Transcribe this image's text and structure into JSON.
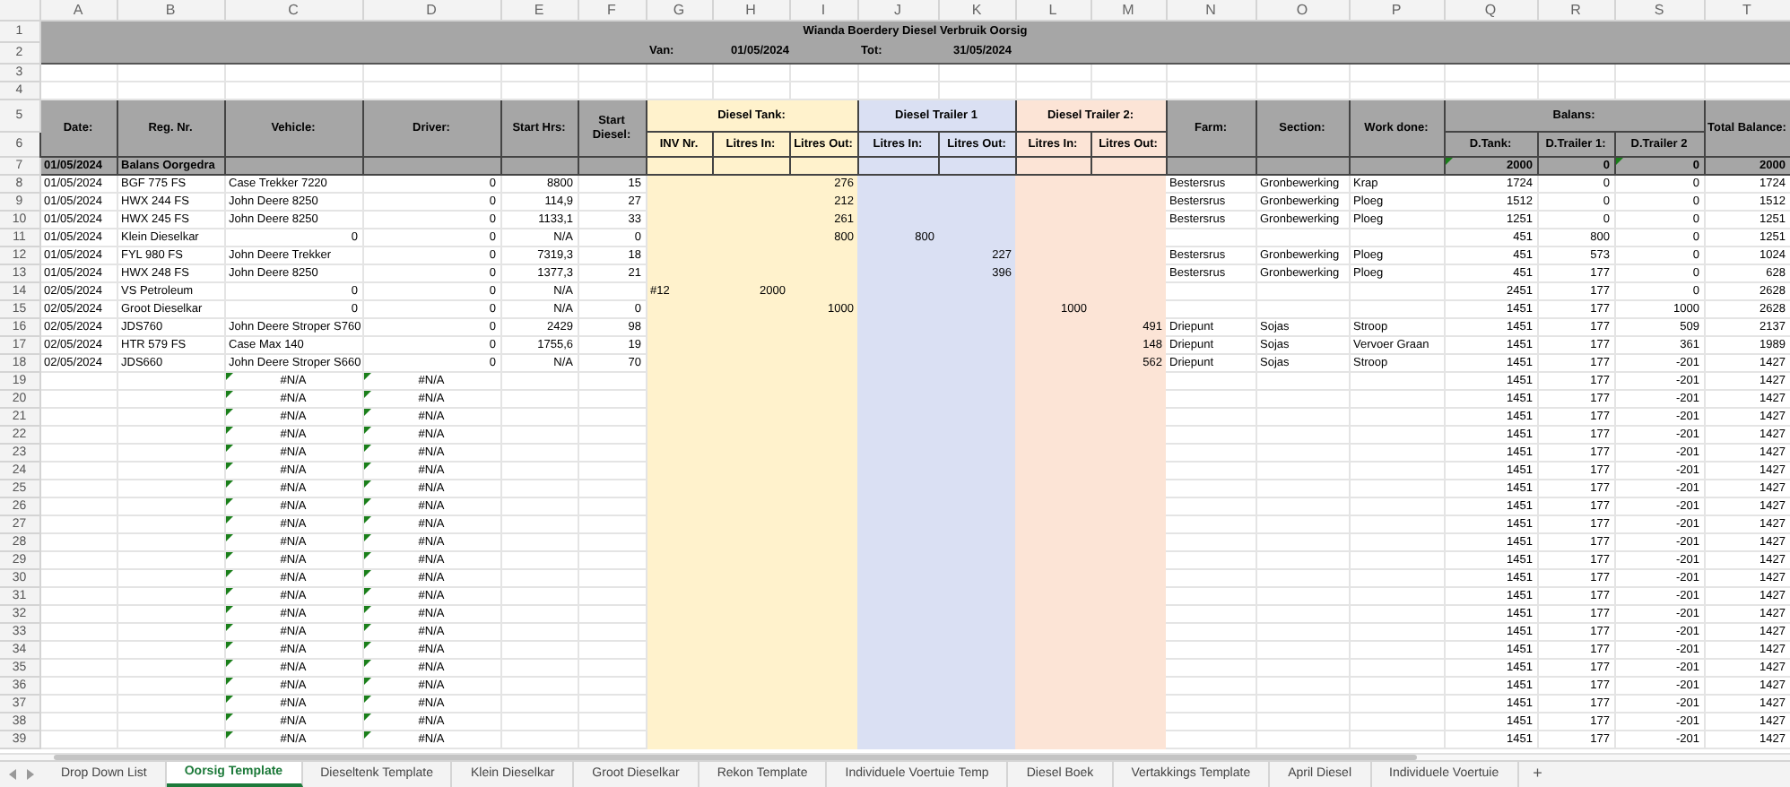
{
  "columns": [
    "A",
    "B",
    "C",
    "D",
    "E",
    "F",
    "G",
    "H",
    "I",
    "J",
    "K",
    "L",
    "M",
    "N",
    "O",
    "P",
    "Q",
    "R",
    "S",
    "T"
  ],
  "title_band": {
    "rows": [
      "1",
      "2"
    ],
    "title": "Wianda Boerdery Diesel Verbruik Oorsig",
    "from_label": "Van:",
    "from": "01/05/2024",
    "to_label": "Tot:",
    "to": "31/05/2024"
  },
  "blank_rows": [
    "3",
    "4"
  ],
  "header_rows": [
    "5",
    "6"
  ],
  "headers": [
    {
      "label": "Date:"
    },
    {
      "label": "Reg. Nr."
    },
    {
      "label": "Vehicle:"
    },
    {
      "label": "Driver:"
    },
    {
      "label": "Start Hrs:"
    },
    {
      "label": "Start Diesel:"
    },
    {
      "label": "Diesel Tank:",
      "color": "#fff2cc",
      "children": [
        "INV Nr.",
        "Litres In:",
        "Litres Out:"
      ]
    },
    {
      "label": "Diesel Trailer 1",
      "color": "#dae0f3",
      "children": [
        "Litres In:",
        "Litres Out:"
      ]
    },
    {
      "label": "Diesel Trailer 2:",
      "color": "#fce4d6",
      "children": [
        "Litres In:",
        "Litres Out:"
      ]
    },
    {
      "label": "Farm:"
    },
    {
      "label": "Section:"
    },
    {
      "label": "Work done:"
    },
    {
      "label": "Balans:",
      "children": [
        "D.Tank:",
        "D.Trailer 1:",
        "D.Trailer 2"
      ]
    },
    {
      "label": "Total Balance:"
    }
  ],
  "rows": [
    {
      "n": "7",
      "kind": "carry",
      "flags": {
        "Q": true,
        "S": true
      },
      "cells": {
        "A": "01/05/2024",
        "B": "Balans Oorgedra",
        "Q": "2000",
        "R": "0",
        "S": "0",
        "T": "2000"
      }
    },
    {
      "n": "8",
      "kind": "entry",
      "cells": {
        "A": "01/05/2024",
        "B": "BGF 775 FS",
        "C": "Case Trekker 7220",
        "D": "0",
        "E": "8800",
        "F": "15",
        "I": "276",
        "N": "Bestersrus",
        "O": "Gronbewerking",
        "P": "Krap",
        "Q": "1724",
        "R": "0",
        "S": "0",
        "T": "1724"
      }
    },
    {
      "n": "9",
      "kind": "entry",
      "cells": {
        "A": "01/05/2024",
        "B": "HWX 244 FS",
        "C": "John Deere 8250",
        "D": "0",
        "E": "114,9",
        "F": "27",
        "I": "212",
        "N": "Bestersrus",
        "O": "Gronbewerking",
        "P": "Ploeg",
        "Q": "1512",
        "R": "0",
        "S": "0",
        "T": "1512"
      }
    },
    {
      "n": "10",
      "kind": "entry",
      "cells": {
        "A": "01/05/2024",
        "B": "HWX 245 FS",
        "C": "John Deere 8250",
        "D": "0",
        "E": "1133,1",
        "F": "33",
        "I": "261",
        "N": "Bestersrus",
        "O": "Gronbewerking",
        "P": "Ploeg",
        "Q": "1251",
        "R": "0",
        "S": "0",
        "T": "1251"
      }
    },
    {
      "n": "11",
      "kind": "entry",
      "cells": {
        "A": "01/05/2024",
        "B": "Klein Dieselkar",
        "C": "0",
        "D": "0",
        "E": "N/A",
        "F": "0",
        "I": "800",
        "J": "800",
        "Q": "451",
        "R": "800",
        "S": "0",
        "T": "1251"
      }
    },
    {
      "n": "12",
      "kind": "entry",
      "cells": {
        "A": "01/05/2024",
        "B": "FYL 980 FS",
        "C": "John Deere Trekker",
        "D": "0",
        "E": "7319,3",
        "F": "18",
        "K": "227",
        "N": "Bestersrus",
        "O": "Gronbewerking",
        "P": "Ploeg",
        "Q": "451",
        "R": "573",
        "S": "0",
        "T": "1024"
      }
    },
    {
      "n": "13",
      "kind": "entry",
      "cells": {
        "A": "01/05/2024",
        "B": "HWX 248 FS",
        "C": "John Deere 8250",
        "D": "0",
        "E": "1377,3",
        "F": "21",
        "K": "396",
        "N": "Bestersrus",
        "O": "Gronbewerking",
        "P": "Ploeg",
        "Q": "451",
        "R": "177",
        "S": "0",
        "T": "628"
      }
    },
    {
      "n": "14",
      "kind": "entry",
      "cells": {
        "A": "02/05/2024",
        "B": "VS Petroleum",
        "C": "0",
        "D": "0",
        "E": "N/A",
        "G": "#12",
        "H": "2000",
        "Q": "2451",
        "R": "177",
        "S": "0",
        "T": "2628"
      }
    },
    {
      "n": "15",
      "kind": "entry",
      "cells": {
        "A": "02/05/2024",
        "B": "Groot Dieselkar",
        "C": "0",
        "D": "0",
        "E": "N/A",
        "F": "0",
        "I": "1000",
        "L": "1000",
        "Q": "1451",
        "R": "177",
        "S": "1000",
        "T": "2628"
      }
    },
    {
      "n": "16",
      "kind": "entry",
      "cells": {
        "A": "02/05/2024",
        "B": "JDS760",
        "C": "John Deere Stroper S760",
        "D": "0",
        "E": "2429",
        "F": "98",
        "M": "491",
        "N": "Driepunt",
        "O": "Sojas",
        "P": "Stroop",
        "Q": "1451",
        "R": "177",
        "S": "509",
        "T": "2137"
      }
    },
    {
      "n": "17",
      "kind": "entry",
      "cells": {
        "A": "02/05/2024",
        "B": "HTR 579 FS",
        "C": "Case Max 140",
        "D": "0",
        "E": "1755,6",
        "F": "19",
        "M": "148",
        "N": "Driepunt",
        "O": "Sojas",
        "P": "Vervoer Graan",
        "Q": "1451",
        "R": "177",
        "S": "361",
        "T": "1989"
      }
    },
    {
      "n": "18",
      "kind": "entry",
      "cells": {
        "A": "02/05/2024",
        "B": "JDS660",
        "C": "John Deere Stroper S660",
        "D": "0",
        "E": "N/A",
        "F": "70",
        "M": "562",
        "N": "Driepunt",
        "O": "Sojas",
        "P": "Stroop",
        "Q": "1451",
        "R": "177",
        "S": "-201",
        "T": "1427"
      }
    },
    {
      "n": "19",
      "kind": "entry",
      "flags": {
        "C": true,
        "D": true
      },
      "cells": {
        "C": "#N/A",
        "D": "#N/A",
        "Q": "1451",
        "R": "177",
        "S": "-201",
        "T": "1427"
      }
    },
    {
      "n": "20",
      "kind": "entry",
      "flags": {
        "C": true,
        "D": true
      },
      "cells": {
        "C": "#N/A",
        "D": "#N/A",
        "Q": "1451",
        "R": "177",
        "S": "-201",
        "T": "1427"
      }
    },
    {
      "n": "21",
      "kind": "entry",
      "flags": {
        "C": true,
        "D": true
      },
      "cells": {
        "C": "#N/A",
        "D": "#N/A",
        "Q": "1451",
        "R": "177",
        "S": "-201",
        "T": "1427"
      }
    },
    {
      "n": "22",
      "kind": "entry",
      "flags": {
        "C": true,
        "D": true
      },
      "cells": {
        "C": "#N/A",
        "D": "#N/A",
        "Q": "1451",
        "R": "177",
        "S": "-201",
        "T": "1427"
      }
    },
    {
      "n": "23",
      "kind": "entry",
      "flags": {
        "C": true,
        "D": true
      },
      "cells": {
        "C": "#N/A",
        "D": "#N/A",
        "Q": "1451",
        "R": "177",
        "S": "-201",
        "T": "1427"
      }
    },
    {
      "n": "24",
      "kind": "entry",
      "flags": {
        "C": true,
        "D": true
      },
      "cells": {
        "C": "#N/A",
        "D": "#N/A",
        "Q": "1451",
        "R": "177",
        "S": "-201",
        "T": "1427"
      }
    },
    {
      "n": "25",
      "kind": "entry",
      "flags": {
        "C": true,
        "D": true
      },
      "cells": {
        "C": "#N/A",
        "D": "#N/A",
        "Q": "1451",
        "R": "177",
        "S": "-201",
        "T": "1427"
      }
    },
    {
      "n": "26",
      "kind": "entry",
      "flags": {
        "C": true,
        "D": true
      },
      "cells": {
        "C": "#N/A",
        "D": "#N/A",
        "Q": "1451",
        "R": "177",
        "S": "-201",
        "T": "1427"
      }
    },
    {
      "n": "27",
      "kind": "entry",
      "flags": {
        "C": true,
        "D": true
      },
      "cells": {
        "C": "#N/A",
        "D": "#N/A",
        "Q": "1451",
        "R": "177",
        "S": "-201",
        "T": "1427"
      }
    },
    {
      "n": "28",
      "kind": "entry",
      "flags": {
        "C": true,
        "D": true
      },
      "cells": {
        "C": "#N/A",
        "D": "#N/A",
        "Q": "1451",
        "R": "177",
        "S": "-201",
        "T": "1427"
      }
    },
    {
      "n": "29",
      "kind": "entry",
      "flags": {
        "C": true,
        "D": true
      },
      "cells": {
        "C": "#N/A",
        "D": "#N/A",
        "Q": "1451",
        "R": "177",
        "S": "-201",
        "T": "1427"
      }
    },
    {
      "n": "30",
      "kind": "entry",
      "flags": {
        "C": true,
        "D": true
      },
      "cells": {
        "C": "#N/A",
        "D": "#N/A",
        "Q": "1451",
        "R": "177",
        "S": "-201",
        "T": "1427"
      }
    },
    {
      "n": "31",
      "kind": "entry",
      "flags": {
        "C": true,
        "D": true
      },
      "cells": {
        "C": "#N/A",
        "D": "#N/A",
        "Q": "1451",
        "R": "177",
        "S": "-201",
        "T": "1427"
      }
    },
    {
      "n": "32",
      "kind": "entry",
      "flags": {
        "C": true,
        "D": true
      },
      "cells": {
        "C": "#N/A",
        "D": "#N/A",
        "Q": "1451",
        "R": "177",
        "S": "-201",
        "T": "1427"
      }
    },
    {
      "n": "33",
      "kind": "entry",
      "flags": {
        "C": true,
        "D": true
      },
      "cells": {
        "C": "#N/A",
        "D": "#N/A",
        "Q": "1451",
        "R": "177",
        "S": "-201",
        "T": "1427"
      }
    },
    {
      "n": "34",
      "kind": "entry",
      "flags": {
        "C": true,
        "D": true
      },
      "cells": {
        "C": "#N/A",
        "D": "#N/A",
        "Q": "1451",
        "R": "177",
        "S": "-201",
        "T": "1427"
      }
    },
    {
      "n": "35",
      "kind": "entry",
      "flags": {
        "C": true,
        "D": true
      },
      "cells": {
        "C": "#N/A",
        "D": "#N/A",
        "Q": "1451",
        "R": "177",
        "S": "-201",
        "T": "1427"
      }
    },
    {
      "n": "36",
      "kind": "entry",
      "flags": {
        "C": true,
        "D": true
      },
      "cells": {
        "C": "#N/A",
        "D": "#N/A",
        "Q": "1451",
        "R": "177",
        "S": "-201",
        "T": "1427"
      }
    },
    {
      "n": "37",
      "kind": "entry",
      "flags": {
        "C": true,
        "D": true
      },
      "cells": {
        "C": "#N/A",
        "D": "#N/A",
        "Q": "1451",
        "R": "177",
        "S": "-201",
        "T": "1427"
      }
    },
    {
      "n": "38",
      "kind": "entry",
      "flags": {
        "C": true,
        "D": true
      },
      "cells": {
        "C": "#N/A",
        "D": "#N/A",
        "Q": "1451",
        "R": "177",
        "S": "-201",
        "T": "1427"
      }
    },
    {
      "n": "39",
      "kind": "entry",
      "flags": {
        "C": true,
        "D": true
      },
      "cells": {
        "C": "#N/A",
        "D": "#N/A",
        "Q": "1451",
        "R": "177",
        "S": "-201",
        "T": "1427"
      }
    }
  ],
  "sheet_tabs": [
    {
      "label": "Drop Down List",
      "selected": false
    },
    {
      "label": "Oorsig Template",
      "selected": true
    },
    {
      "label": "Dieseltenk Template",
      "selected": false
    },
    {
      "label": "Klein Dieselkar",
      "selected": false
    },
    {
      "label": "Groot Dieselkar",
      "selected": false
    },
    {
      "label": "Rekon Template",
      "selected": false
    },
    {
      "label": "Individuele Voertuie Temp",
      "selected": false
    },
    {
      "label": "Diesel Boek",
      "selected": false
    },
    {
      "label": "Vertakkings Template",
      "selected": false
    },
    {
      "label": "April Diesel",
      "selected": false
    },
    {
      "label": "Individuele Voertuie",
      "selected": false
    }
  ],
  "add_sheet": "+"
}
